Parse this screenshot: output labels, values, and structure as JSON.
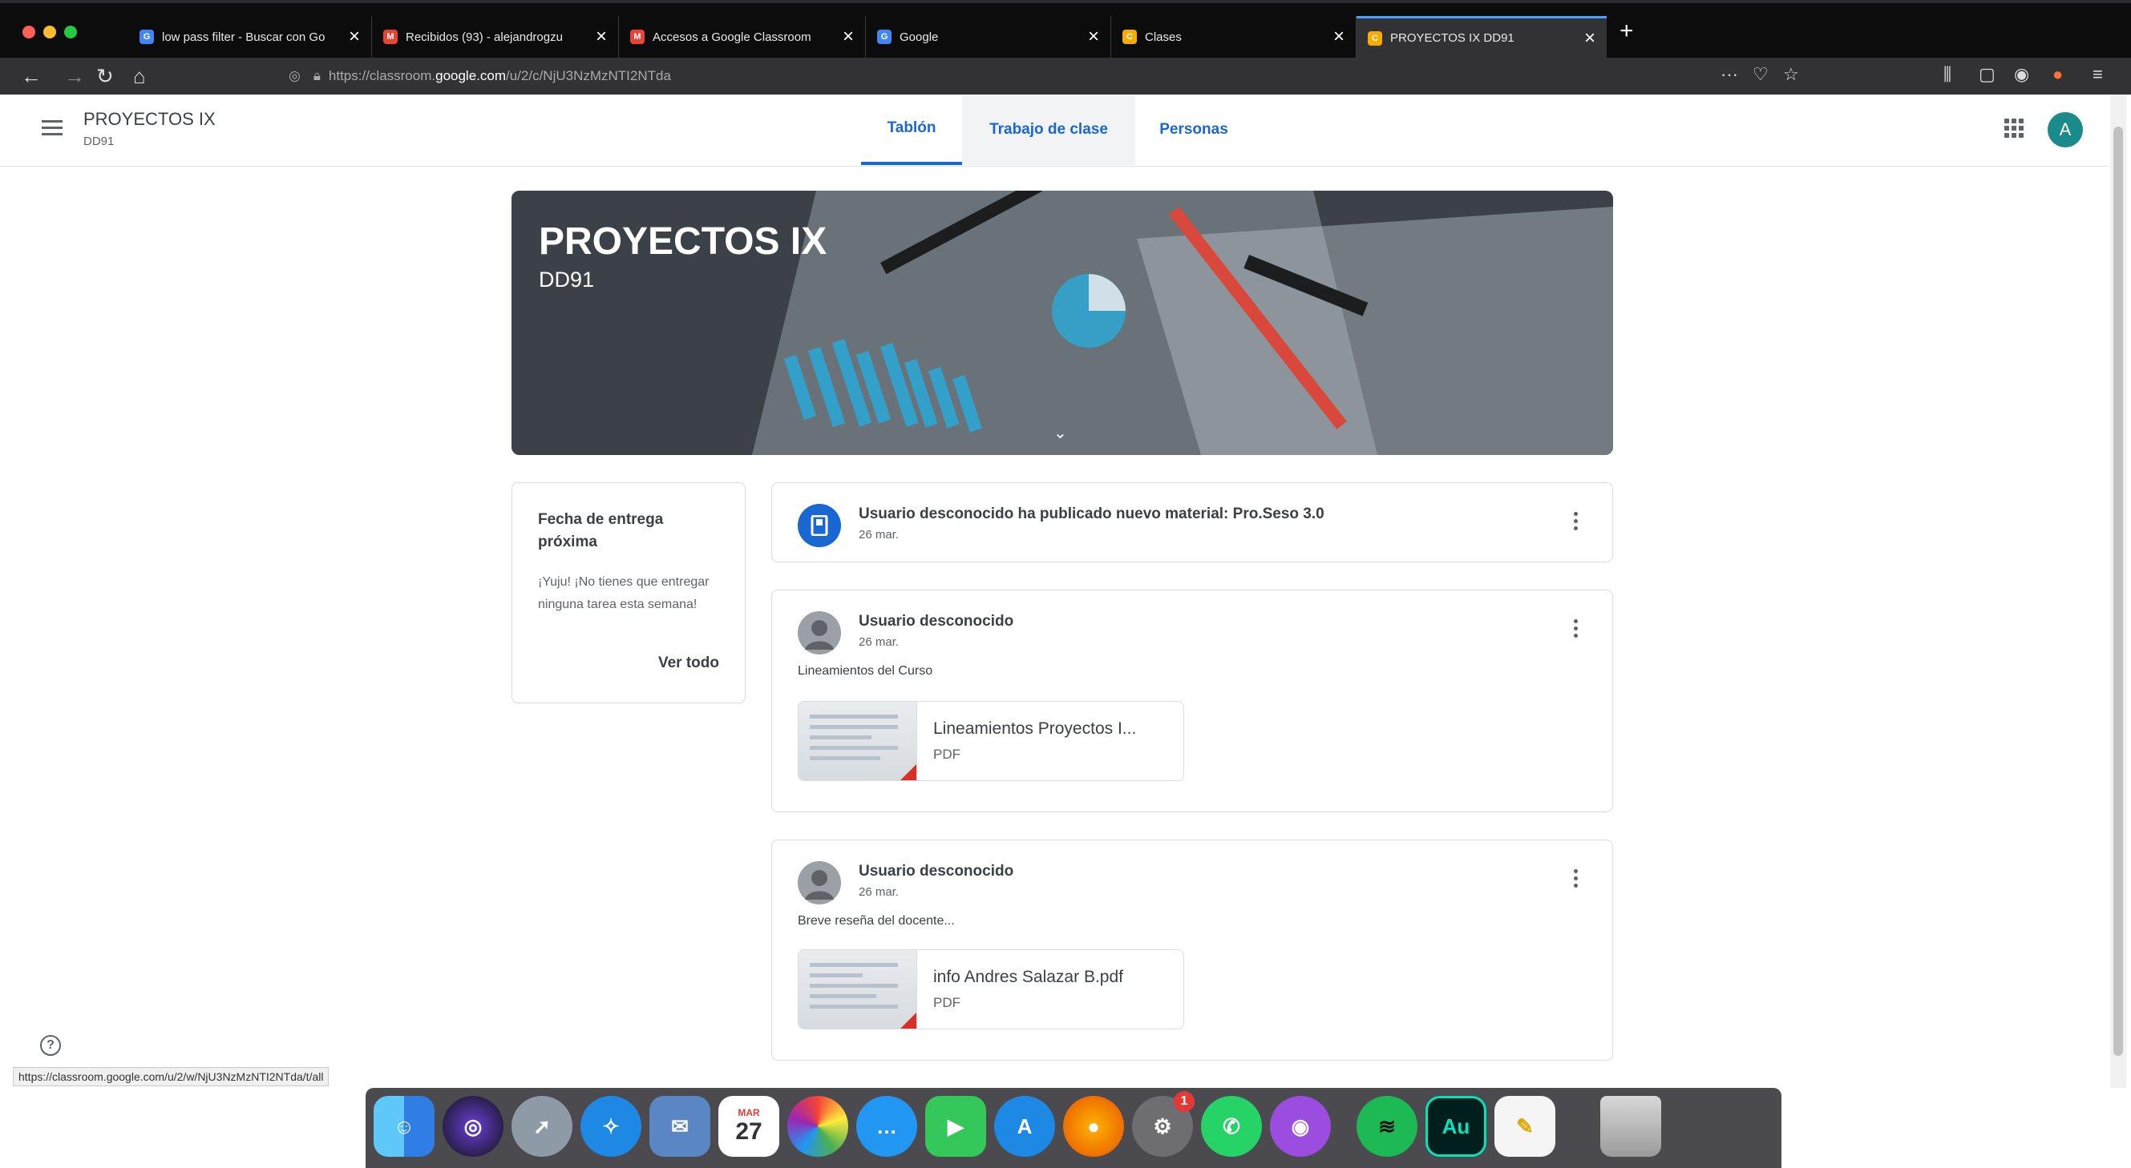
{
  "browser": {
    "tabs": [
      {
        "label": "low pass filter - Buscar con Go",
        "icon": "google-icon",
        "color": "#4285f4"
      },
      {
        "label": "Recibidos (93) - alejandrogzu",
        "icon": "gmail-icon",
        "color": "#ea4335"
      },
      {
        "label": "Accesos a Google Classroom",
        "icon": "gmail-icon",
        "color": "#ea4335"
      },
      {
        "label": "Google",
        "icon": "google-icon",
        "color": "#4285f4"
      },
      {
        "label": "Clases",
        "icon": "classroom-icon",
        "color": "#f9ab00"
      },
      {
        "label": "PROYECTOS IX DD91",
        "icon": "classroom-icon",
        "color": "#f9ab00",
        "active": true
      }
    ],
    "url_prefix": "https://classroom.",
    "url_domain": "google.com",
    "url_path": "/u/2/c/NjU3NzMzNTI2NTda",
    "status_url": "https://classroom.google.com/u/2/w/NjU3NzMzNTI2NTda/t/all"
  },
  "header": {
    "class_name": "PROYECTOS IX",
    "section": "DD91",
    "tabs": [
      "Tablón",
      "Trabajo de clase",
      "Personas"
    ],
    "avatar_letter": "A"
  },
  "banner": {
    "title": "PROYECTOS IX",
    "subtitle": "DD91"
  },
  "upcoming": {
    "title": "Fecha de entrega próxima",
    "message": "¡Yuju! ¡No tienes que entregar ninguna tarea esta semana!",
    "link": "Ver todo"
  },
  "stream": [
    {
      "title": "Usuario desconocido ha publicado nuevo material: Pro.Seso 3.0",
      "date": "26 mar."
    },
    {
      "title": "Usuario desconocido",
      "date": "26 mar.",
      "body": "Lineamientos del Curso",
      "attachment": {
        "title": "Lineamientos Proyectos I...",
        "type": "PDF"
      }
    },
    {
      "title": "Usuario desconocido",
      "date": "26 mar.",
      "body": "Breve reseña del docente...",
      "attachment": {
        "title": "info Andres Salazar B.pdf",
        "type": "PDF"
      }
    }
  ],
  "dock": {
    "calendar_month": "MAR",
    "calendar_day": "27",
    "settings_badge": "1",
    "audition_label": "Au"
  },
  "colors": {
    "accent": "#1967d2",
    "teal_avatar": "#1a8a8a"
  }
}
